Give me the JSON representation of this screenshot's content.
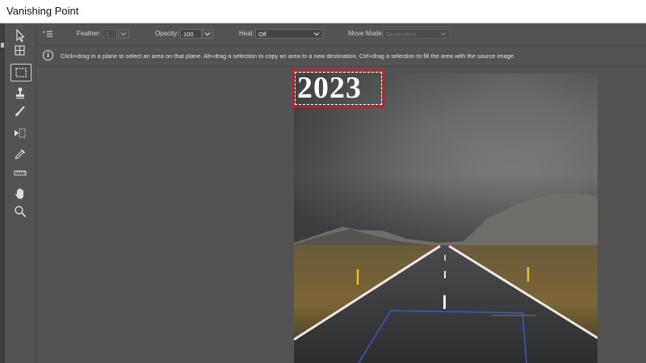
{
  "window": {
    "title": "Vanishing Point"
  },
  "toolbar": {
    "tools": [
      {
        "icon": "edit-plane-icon"
      },
      {
        "icon": "create-plane-icon"
      },
      {
        "icon": "marquee-icon",
        "active": true
      },
      {
        "icon": "stamp-icon"
      },
      {
        "icon": "brush-icon"
      },
      {
        "icon": "transform-icon"
      },
      {
        "icon": "eyedropper-icon"
      },
      {
        "icon": "measure-icon"
      },
      {
        "icon": "hand-icon"
      },
      {
        "icon": "zoom-icon"
      }
    ]
  },
  "options": {
    "menu_icon": "panel-menu-icon",
    "feather_label": "Feather:",
    "feather_value": "1",
    "opacity_label": "Opacity:",
    "opacity_value": "100",
    "heal_label": "Heal:",
    "heal_value": "Off",
    "move_mode_label": "Move Mode:",
    "move_mode_value": "Destination"
  },
  "info": {
    "icon": "info-icon",
    "text": "Click+drag in a plane to select an area on that plane. Alt+drag a selection to copy an area to a new destination. Ctrl+drag a selection to fill the area with the source image."
  },
  "canvas": {
    "selection_text": "2023",
    "highlight_color": "#e0171c"
  }
}
